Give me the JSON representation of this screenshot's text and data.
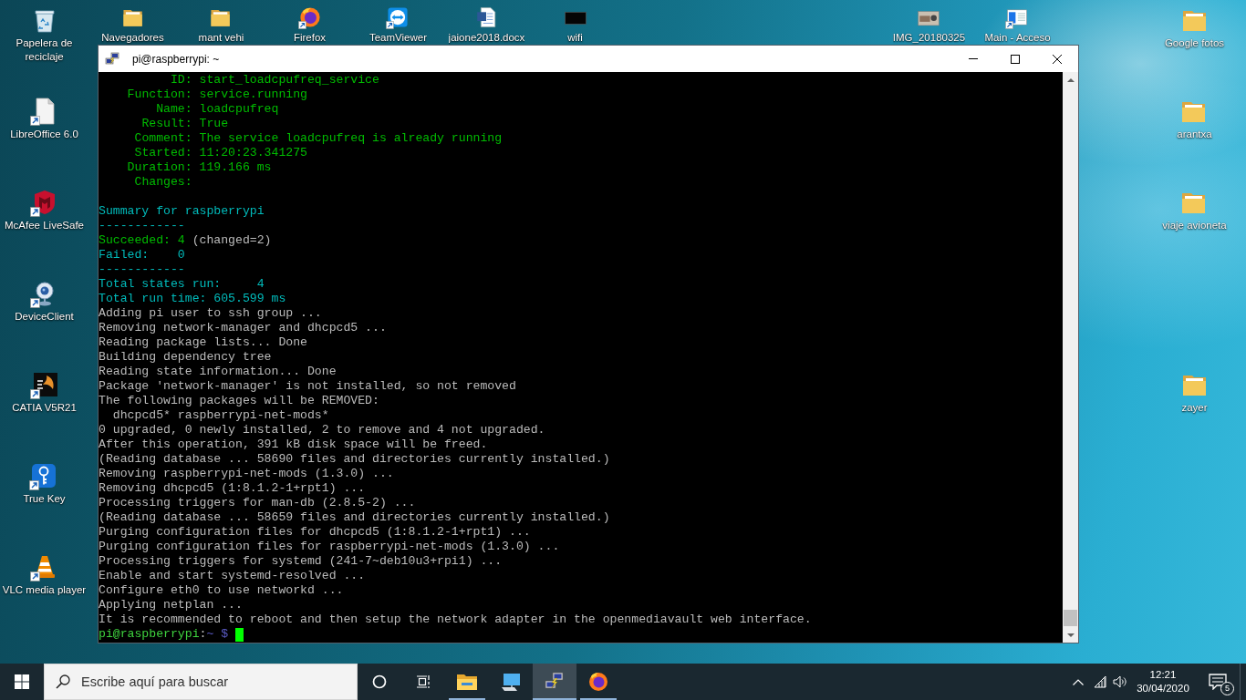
{
  "desktop": {
    "left_column": [
      {
        "label": "Papelera de reciclaje",
        "kind": "recycle-bin",
        "shortcut": false
      },
      {
        "label": "LibreOffice 6.0",
        "kind": "libreoffice",
        "shortcut": true
      },
      {
        "label": "McAfee LiveSafe",
        "kind": "mcafee",
        "shortcut": true
      },
      {
        "label": "DeviceClient",
        "kind": "webcam",
        "shortcut": true
      },
      {
        "label": "CATIA V5R21",
        "kind": "catia",
        "shortcut": true
      },
      {
        "label": "True Key",
        "kind": "truekey",
        "shortcut": true
      },
      {
        "label": "VLC media player",
        "kind": "vlc",
        "shortcut": true
      }
    ],
    "top_row": [
      {
        "label": "Navegadores",
        "kind": "folder",
        "shortcut": false
      },
      {
        "label": "mant vehi",
        "kind": "folder",
        "shortcut": false
      },
      {
        "label": "Firefox",
        "kind": "firefox",
        "shortcut": true
      },
      {
        "label": "TeamViewer",
        "kind": "teamviewer",
        "shortcut": true
      },
      {
        "label": "jaione2018.docx",
        "kind": "word-document",
        "shortcut": false
      },
      {
        "label": "wifi",
        "kind": "dark-thumbnail",
        "shortcut": false
      }
    ],
    "top_row_right": [
      {
        "label": "IMG_20180325",
        "kind": "photo-thumbnail",
        "shortcut": false
      },
      {
        "label": "Main - Acceso",
        "kind": "app-window",
        "shortcut": true
      }
    ],
    "right_column": [
      {
        "label": "Google fotos",
        "kind": "folder",
        "shortcut": false
      },
      {
        "label": "arantxa",
        "kind": "folder",
        "shortcut": false
      },
      {
        "label": "viaje avioneta",
        "kind": "folder",
        "shortcut": false
      }
    ],
    "right_column_lower": [
      {
        "label": "zayer",
        "kind": "folder",
        "shortcut": false
      }
    ]
  },
  "window": {
    "title": "pi@raspberrypi: ~",
    "terminal": {
      "blocks": [
        {
          "lines": [
            {
              "segments": [
                {
                  "text": "          ID: start_loadcpufreq_service",
                  "color": "#00bb00"
                }
              ]
            },
            {
              "segments": [
                {
                  "text": "    Function: service.running",
                  "color": "#00bb00"
                }
              ]
            },
            {
              "segments": [
                {
                  "text": "        Name: loadcpufreq",
                  "color": "#00bb00"
                }
              ]
            },
            {
              "segments": [
                {
                  "text": "      Result: True",
                  "color": "#00bb00"
                }
              ]
            },
            {
              "segments": [
                {
                  "text": "     Comment: The service loadcpufreq is already running",
                  "color": "#00bb00"
                }
              ]
            },
            {
              "segments": [
                {
                  "text": "     Started: 11:20:23.341275",
                  "color": "#00bb00"
                }
              ]
            },
            {
              "segments": [
                {
                  "text": "    Duration: 119.166 ms",
                  "color": "#00bb00"
                }
              ]
            },
            {
              "segments": [
                {
                  "text": "     Changes:",
                  "color": "#00bb00"
                }
              ]
            }
          ]
        },
        {
          "lines": [
            {
              "segments": [
                {
                  "text": "Summary for raspberrypi",
                  "color": "#00bbbb"
                }
              ]
            },
            {
              "segments": [
                {
                  "text": "------------",
                  "color": "#00bbbb"
                }
              ]
            },
            {
              "segments": [
                {
                  "text": "Succeeded: 4",
                  "color": "#00bb00"
                },
                {
                  "text": " (changed=2)",
                  "color": "#bbbbbb"
                }
              ]
            },
            {
              "segments": [
                {
                  "text": "Failed:    0",
                  "color": "#00bbbb"
                }
              ]
            },
            {
              "segments": [
                {
                  "text": "------------",
                  "color": "#00bbbb"
                }
              ]
            },
            {
              "segments": [
                {
                  "text": "Total states run:     4",
                  "color": "#00bbbb"
                }
              ]
            },
            {
              "segments": [
                {
                  "text": "Total run time: 605.599 ms",
                  "color": "#00bbbb"
                }
              ]
            },
            {
              "segments": [
                {
                  "text": "Adding pi user to ssh group ...",
                  "color": "#bbbbbb"
                }
              ]
            },
            {
              "segments": [
                {
                  "text": "Removing network-manager and dhcpcd5 ...",
                  "color": "#bbbbbb"
                }
              ]
            },
            {
              "segments": [
                {
                  "text": "Reading package lists... Done",
                  "color": "#bbbbbb"
                }
              ]
            },
            {
              "segments": [
                {
                  "text": "Building dependency tree",
                  "color": "#bbbbbb"
                }
              ]
            },
            {
              "segments": [
                {
                  "text": "Reading state information... Done",
                  "color": "#bbbbbb"
                }
              ]
            },
            {
              "segments": [
                {
                  "text": "Package 'network-manager' is not installed, so not removed",
                  "color": "#bbbbbb"
                }
              ]
            },
            {
              "segments": [
                {
                  "text": "The following packages will be REMOVED:",
                  "color": "#bbbbbb"
                }
              ]
            },
            {
              "segments": [
                {
                  "text": "  dhcpcd5* raspberrypi-net-mods*",
                  "color": "#bbbbbb"
                }
              ]
            },
            {
              "segments": [
                {
                  "text": "0 upgraded, 0 newly installed, 2 to remove and 4 not upgraded.",
                  "color": "#bbbbbb"
                }
              ]
            },
            {
              "segments": [
                {
                  "text": "After this operation, 391 kB disk space will be freed.",
                  "color": "#bbbbbb"
                }
              ]
            },
            {
              "segments": [
                {
                  "text": "(Reading database ... 58690 files and directories currently installed.)",
                  "color": "#bbbbbb"
                }
              ]
            },
            {
              "segments": [
                {
                  "text": "Removing raspberrypi-net-mods (1.3.0) ...",
                  "color": "#bbbbbb"
                }
              ]
            },
            {
              "segments": [
                {
                  "text": "Removing dhcpcd5 (1:8.1.2-1+rpt1) ...",
                  "color": "#bbbbbb"
                }
              ]
            },
            {
              "segments": [
                {
                  "text": "Processing triggers for man-db (2.8.5-2) ...",
                  "color": "#bbbbbb"
                }
              ]
            },
            {
              "segments": [
                {
                  "text": "(Reading database ... 58659 files and directories currently installed.)",
                  "color": "#bbbbbb"
                }
              ]
            },
            {
              "segments": [
                {
                  "text": "Purging configuration files for dhcpcd5 (1:8.1.2-1+rpt1) ...",
                  "color": "#bbbbbb"
                }
              ]
            },
            {
              "segments": [
                {
                  "text": "Purging configuration files for raspberrypi-net-mods (1.3.0) ...",
                  "color": "#bbbbbb"
                }
              ]
            },
            {
              "segments": [
                {
                  "text": "Processing triggers for systemd (241-7~deb10u3+rpi1) ...",
                  "color": "#bbbbbb"
                }
              ]
            },
            {
              "segments": [
                {
                  "text": "Enable and start systemd-resolved ...",
                  "color": "#bbbbbb"
                }
              ]
            },
            {
              "segments": [
                {
                  "text": "Configure eth0 to use networkd ...",
                  "color": "#bbbbbb"
                }
              ]
            },
            {
              "segments": [
                {
                  "text": "Applying netplan ...",
                  "color": "#bbbbbb"
                }
              ]
            },
            {
              "segments": [
                {
                  "text": "It is recommended to reboot and then setup the network adapter in the openmediavault web interface.",
                  "color": "#bbbbbb"
                }
              ]
            }
          ]
        }
      ],
      "prompt": {
        "segments": [
          {
            "text": "pi@raspberrypi",
            "color": "#3fd43f"
          },
          {
            "text": ":",
            "color": "#bbbbbb"
          },
          {
            "text": "~ $",
            "color": "#5c5cc8"
          }
        ]
      }
    }
  },
  "taskbar": {
    "search": {
      "placeholder": "Escribe aquí para buscar"
    },
    "apps": [
      {
        "kind": "file-explorer",
        "open": true,
        "selected": false
      },
      {
        "kind": "computer",
        "open": false,
        "selected": false
      },
      {
        "kind": "terminal-client",
        "open": true,
        "selected": true
      },
      {
        "kind": "firefox",
        "open": true,
        "selected": false
      }
    ],
    "clock": {
      "time": "12:21",
      "date": "30/04/2020"
    },
    "notifications": {
      "count": "5"
    }
  }
}
